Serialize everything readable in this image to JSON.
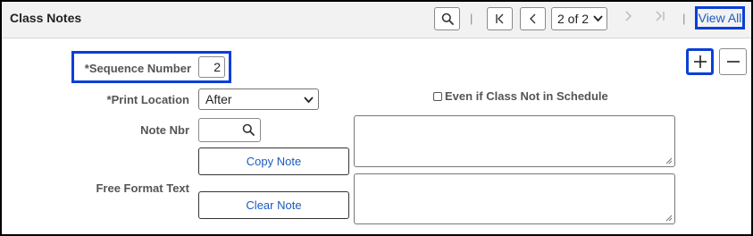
{
  "header": {
    "title": "Class Notes",
    "pager_value": "2 of 2",
    "view_all_label": "View All",
    "separator": "|"
  },
  "form": {
    "sequence_number_label": "*Sequence Number",
    "sequence_number_value": "2",
    "print_location_label": "*Print Location",
    "print_location_value": "After",
    "checkbox_label": "Even if Class Not in Schedule",
    "checkbox_checked": false,
    "note_nbr_label": "Note Nbr",
    "note_nbr_value": "",
    "copy_note_label": "Copy Note",
    "free_format_text_label": "Free Format Text",
    "clear_note_label": "Clear Note"
  },
  "icons": {
    "search": "search-icon",
    "first": "first-page-icon",
    "prev": "chevron-left-icon",
    "next": "chevron-right-icon",
    "last": "last-page-icon",
    "add": "plus-icon",
    "delete": "minus-icon"
  },
  "colors": {
    "highlight": "#0b3fd6",
    "link": "#1a5bbf",
    "header_bg": "#f2f2f2"
  }
}
